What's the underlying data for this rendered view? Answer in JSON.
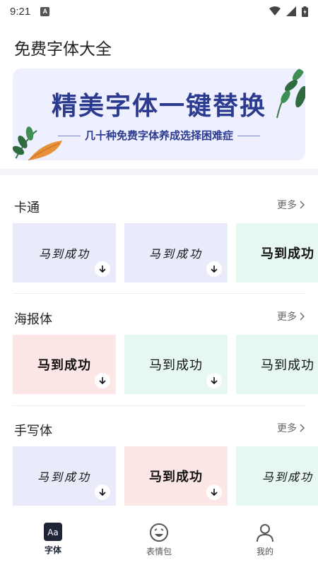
{
  "status": {
    "time": "9:21",
    "badge": "A"
  },
  "app": {
    "title": "免费字体大全"
  },
  "banner": {
    "title": "精美字体一键替换",
    "subtitle": "几十种免费字体养成选择困难症"
  },
  "sections": [
    {
      "title": "卡通",
      "more": "更多",
      "cards": [
        {
          "text": "马到成功",
          "bg": "#e9ebfb"
        },
        {
          "text": "马到成功",
          "bg": "#e9ebfb"
        },
        {
          "text": "马到成功",
          "bg": "#e7f8f1"
        }
      ]
    },
    {
      "title": "海报体",
      "more": "更多",
      "cards": [
        {
          "text": "马到成功",
          "bg": "#fde6e6"
        },
        {
          "text": "马到成功",
          "bg": "#e7f8f1"
        },
        {
          "text": "马到成功",
          "bg": "#e7f8f1"
        }
      ]
    },
    {
      "title": "手写体",
      "more": "更多",
      "cards": [
        {
          "text": "马到成功",
          "bg": "#e9ebfb"
        },
        {
          "text": "马到成功",
          "bg": "#fde6e6"
        },
        {
          "text": "马到成功",
          "bg": "#e7f8f1"
        }
      ]
    }
  ],
  "tabs": [
    {
      "label": "字体",
      "icon": "font-aa-icon",
      "active": true
    },
    {
      "label": "表情包",
      "icon": "emoji-icon",
      "active": false
    },
    {
      "label": "我的",
      "icon": "profile-icon",
      "active": false
    }
  ],
  "colors": {
    "banner_text": "#2c3b8f",
    "active_tab_icon": "#1f2437"
  }
}
